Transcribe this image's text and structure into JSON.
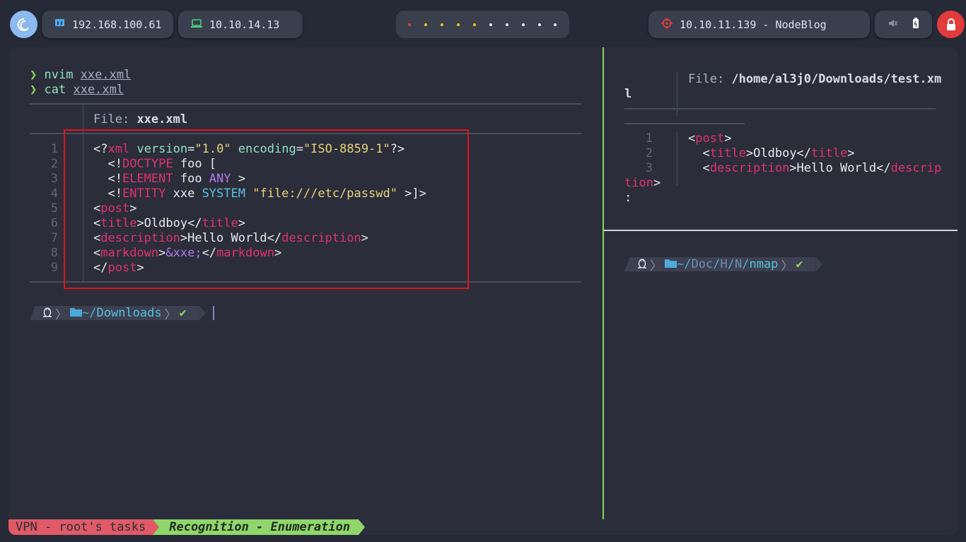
{
  "topbar": {
    "host_ip": "192.168.100.61",
    "vpn_ip": "10.10.14.13",
    "target": "10.10.11.139 - NodeBlog",
    "workspace_dot_colors": [
      "#e23b3b",
      "#f0c419",
      "#f0c419",
      "#f0c419",
      "#f0c419",
      "#e8eaf0",
      "#e8eaf0",
      "#e8eaf0",
      "#e8eaf0",
      "#e8eaf0"
    ],
    "icons": [
      "debian-icon",
      "network-icon",
      "laptop-icon",
      "target-icon",
      "mute-icon",
      "battery-icon",
      "lock-icon"
    ]
  },
  "left_pane": {
    "history": [
      {
        "cmd": "nvim",
        "arg": "xxe.xml"
      },
      {
        "cmd": "cat",
        "arg": "xxe.xml"
      }
    ],
    "file_label": "File:",
    "file_name": "xxe.xml",
    "line_numbers": [
      "1",
      "2",
      "3",
      "4",
      "5",
      "6",
      "7",
      "8",
      "9"
    ],
    "prompt": {
      "dir_prefix": "~/",
      "dir": "Downloads",
      "check": "✔"
    }
  },
  "right_pane": {
    "file_label": "File:",
    "file_path_1": "/home/al3j0/Downloads/test.xm",
    "file_path_2": "l",
    "line_numbers": [
      "1",
      "2",
      "3"
    ],
    "wrap_tail": "tion>",
    "pager_prompt": ":",
    "prompt": {
      "dir_prefix": "~/",
      "seg1": "Doc",
      "seg2": "H",
      "seg3": "N",
      "dir": "nmap",
      "check": "✔"
    }
  },
  "status_bar": {
    "left": "VPN - root's tasks",
    "right": "Recognition - Enumeration"
  }
}
